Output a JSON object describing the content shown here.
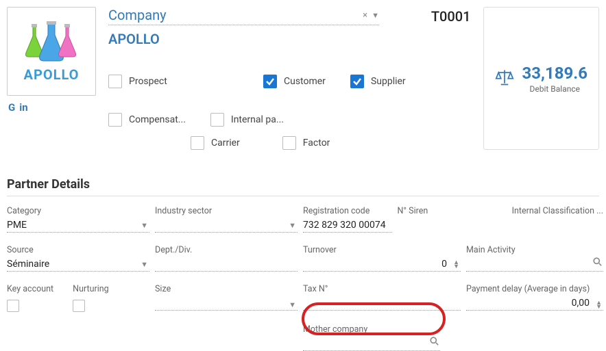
{
  "header": {
    "companyTypeLabel": "Company",
    "companyName": "APOLLO",
    "code": "T0001",
    "logoText": "APOLLO"
  },
  "balance": {
    "value": "33,189.6",
    "label": "Debit Balance"
  },
  "social": {
    "google": "G",
    "linkedin": "in"
  },
  "checks": {
    "prospect": "Prospect",
    "customer": "Customer",
    "supplier": "Supplier",
    "compensation": "Compensat...",
    "internal": "Internal pa...",
    "carrier": "Carrier",
    "factor": "Factor"
  },
  "section": {
    "title": "Partner Details"
  },
  "fields": {
    "category": {
      "label": "Category",
      "value": "PME"
    },
    "industry": {
      "label": "Industry sector",
      "value": ""
    },
    "regcode": {
      "label": "Registration code",
      "value": "732 829 320 00074"
    },
    "siren": {
      "label": "N° Siren",
      "value": ""
    },
    "intclass": {
      "label": "Internal Classification ..."
    },
    "source": {
      "label": "Source",
      "value": "Séminaire"
    },
    "dept": {
      "label": "Dept./Div.",
      "value": ""
    },
    "turnover": {
      "label": "Turnover",
      "value": "0"
    },
    "mainact": {
      "label": "Main Activity",
      "value": ""
    },
    "keyacct": {
      "label": "Key account"
    },
    "nurturing": {
      "label": "Nurturing"
    },
    "size": {
      "label": "Size",
      "value": ""
    },
    "taxno": {
      "label": "Tax N°",
      "value": ""
    },
    "paydelay": {
      "label": "Payment delay (Average in days)",
      "value": "0,00"
    },
    "mother": {
      "label": "Mother company",
      "value": ""
    }
  }
}
